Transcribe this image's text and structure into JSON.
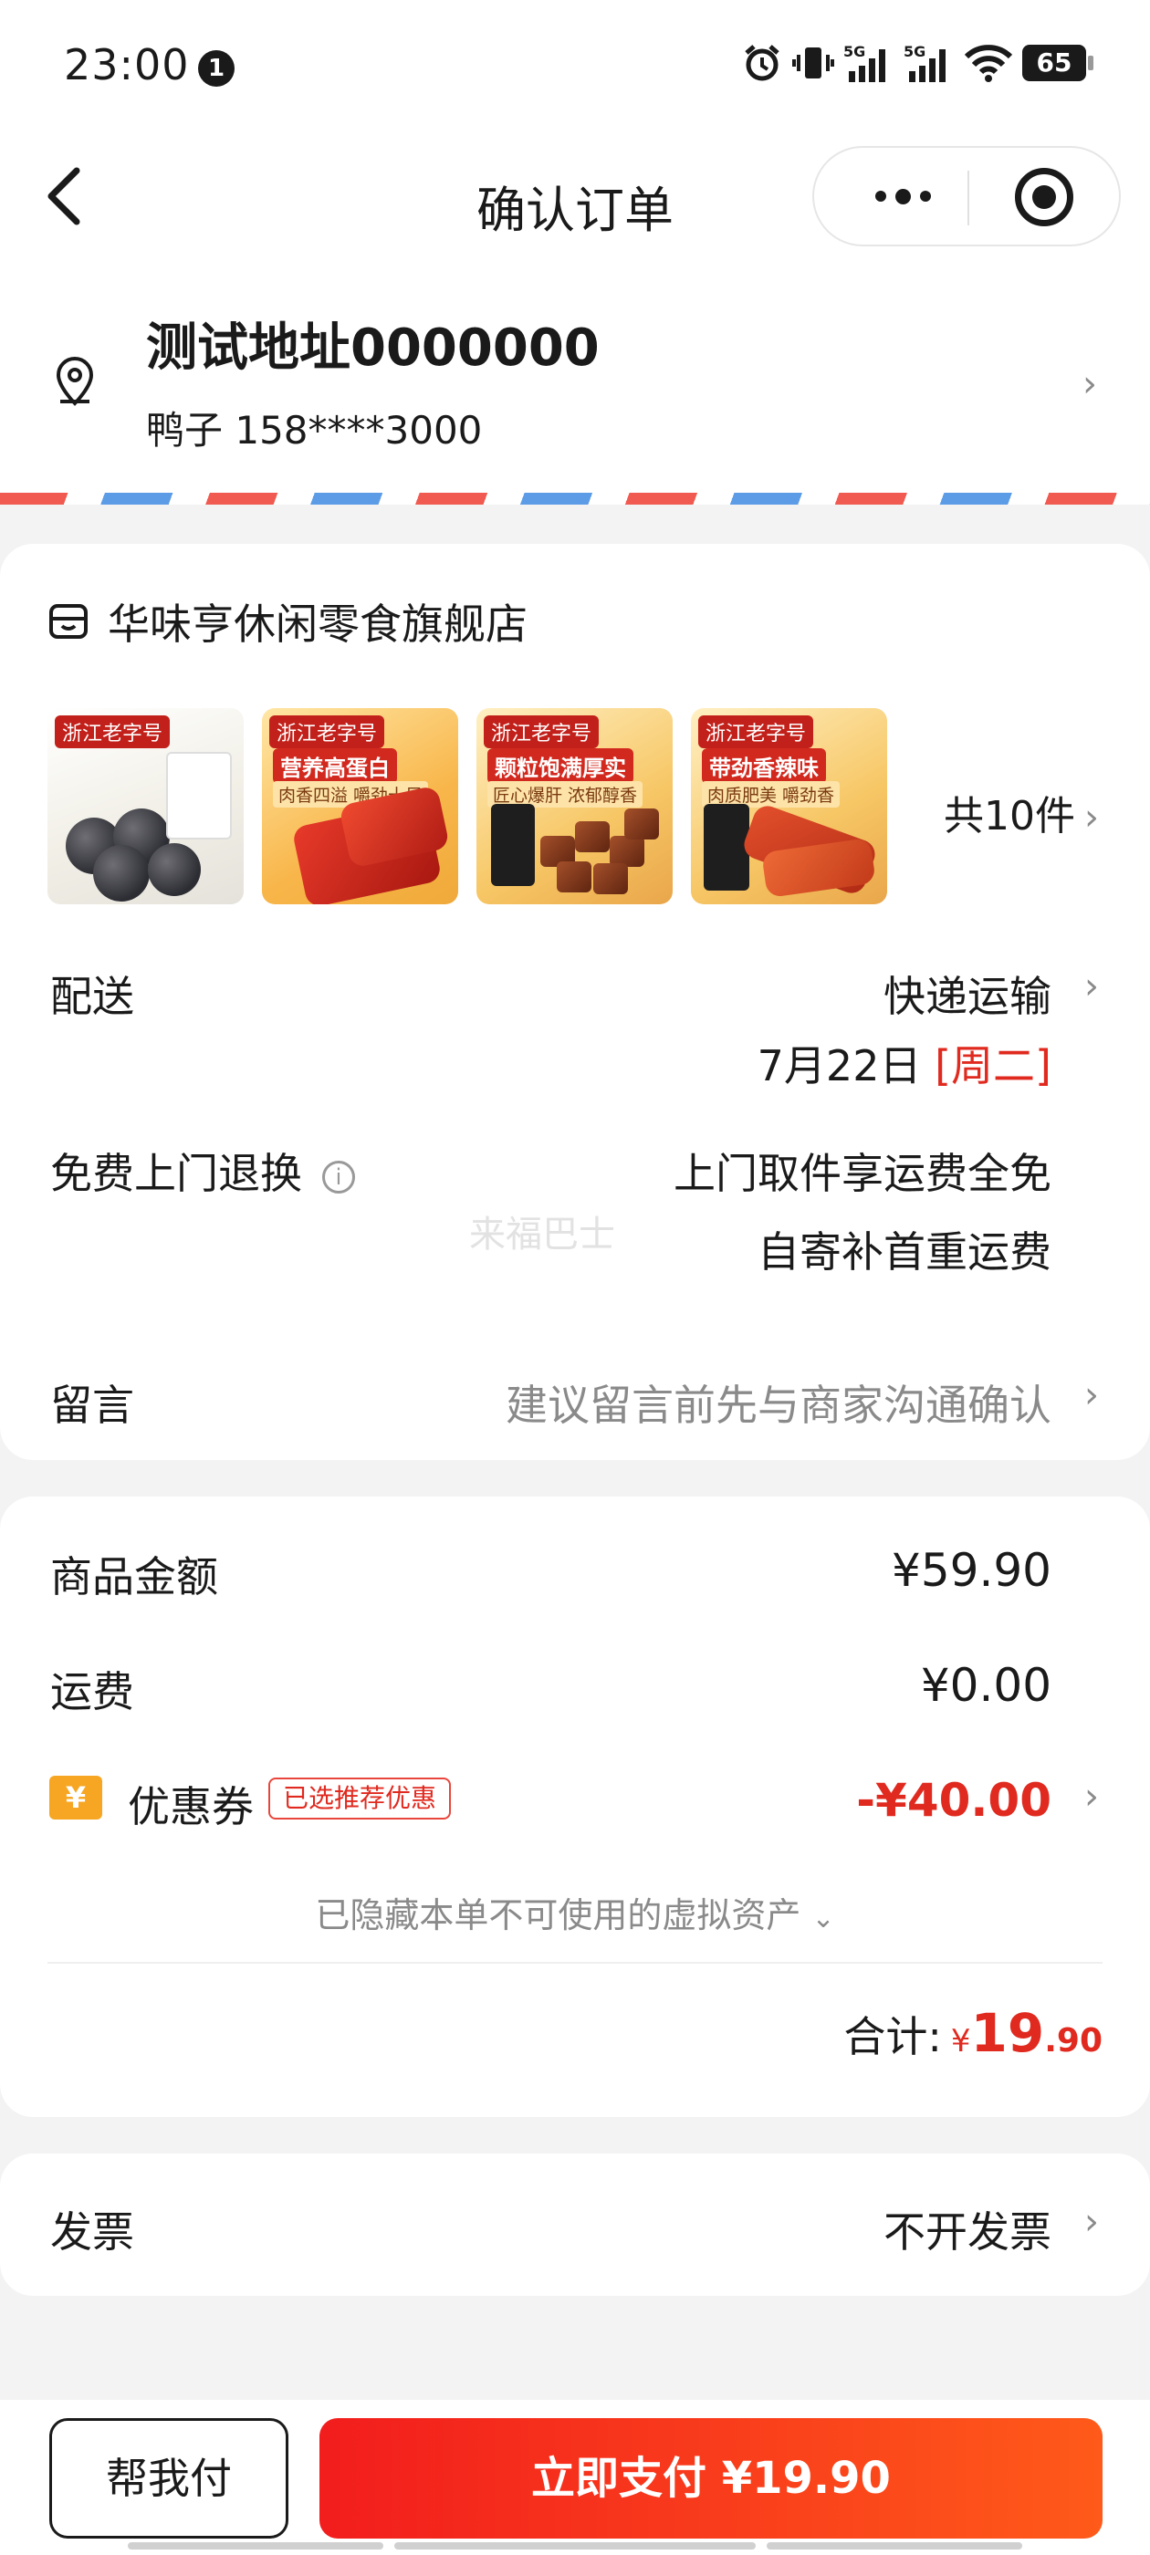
{
  "status_bar": {
    "time": "23:00",
    "notification_count": "1",
    "battery": "65"
  },
  "nav": {
    "title": "确认订单"
  },
  "address": {
    "title": "测试地址0000000",
    "contact": "鸭子 158****3000"
  },
  "store": {
    "name": "华味亨休闲零食旗舰店",
    "thumb_tags": [
      "浙江老字号",
      "浙江老字号",
      "浙江老字号",
      "浙江老字号"
    ],
    "thumb_captions": [
      "",
      "营养高蛋白",
      "颗粒饱满厚实",
      "带劲香辣味"
    ],
    "thumb_subcaptions": [
      "",
      "肉香四溢 嚼劲十足",
      "匠心爆肝 浓郁醇香",
      "肉质肥美 嚼劲香"
    ],
    "item_count": "共10件"
  },
  "delivery": {
    "label": "配送",
    "method": "快递运输",
    "date": "7月22日",
    "weekday": "[周二]"
  },
  "return": {
    "label": "免费上门退换",
    "line1": "上门取件享运费全免",
    "line2": "自寄补首重运费"
  },
  "watermark": "来福巴士",
  "message": {
    "label": "留言",
    "placeholder": "建议留言前先与商家沟通确认"
  },
  "price": {
    "goods_label": "商品金额",
    "goods_value": "¥59.90",
    "shipping_label": "运费",
    "shipping_value": "¥0.00",
    "coupon_label": "优惠券",
    "coupon_badge": "已选推荐优惠",
    "coupon_value": "-¥40.00",
    "coupon_icon": "¥",
    "hidden_note": "已隐藏本单不可使用的虚拟资产",
    "total_label": "合计:",
    "total_currency": "¥",
    "total_int": "19",
    "total_dec": ".90"
  },
  "invoice": {
    "label": "发票",
    "value": "不开发票"
  },
  "bottom": {
    "help_label": "帮我付",
    "pay_label": "立即支付 ¥19.90"
  },
  "colors": {
    "accent": "#e02a1f",
    "pay_start": "#f21d1d",
    "pay_end": "#ff5a1a"
  }
}
